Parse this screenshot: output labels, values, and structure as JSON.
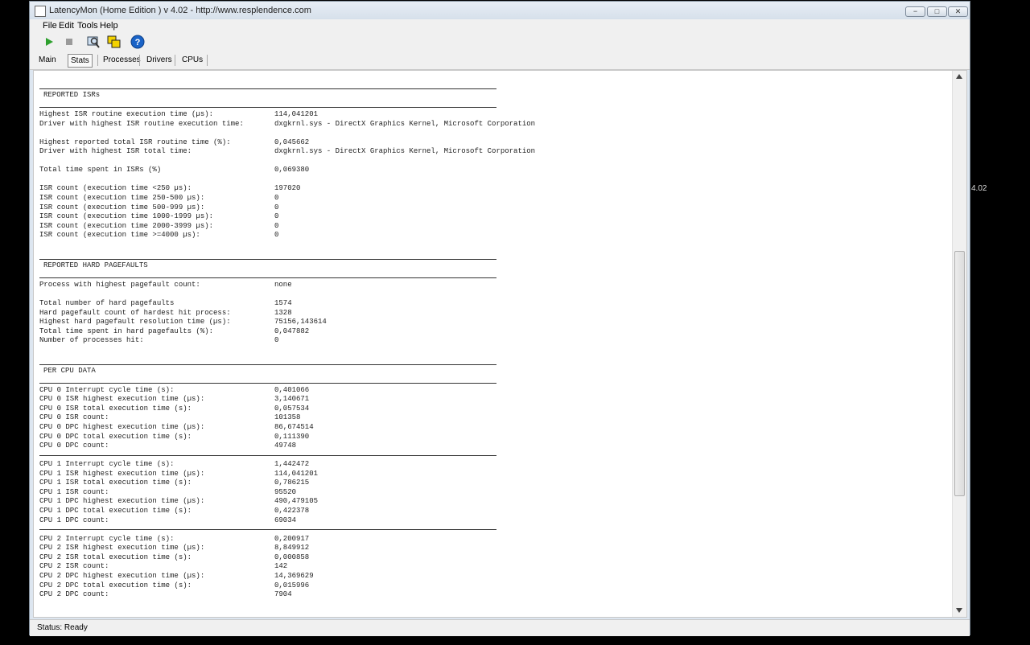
{
  "background_label": "4.02",
  "window": {
    "title": "LatencyMon  (Home Edition )  v 4.02 - http://www.resplendence.com",
    "minimize": "−",
    "maximize": "□",
    "close": "✕"
  },
  "menu": [
    "File",
    "Edit",
    "Tools",
    "Help"
  ],
  "toolbar_icons": [
    "play-icon",
    "stop-icon",
    "search-icon",
    "windows-icon",
    "help-icon"
  ],
  "tabs": [
    "Main",
    "Stats",
    "Processes",
    "Drivers",
    "CPUs"
  ],
  "active_tab": "Stats",
  "sections": [
    {
      "header": "REPORTED ISRs",
      "groups": [
        [
          {
            "label": "Highest ISR routine execution time (µs):",
            "value": "114,041201"
          },
          {
            "label": "Driver with highest ISR routine execution time:",
            "value": "dxgkrnl.sys - DirectX Graphics Kernel, Microsoft Corporation"
          }
        ],
        [
          {
            "label": "Highest reported total ISR routine time (%):",
            "value": "0,045662"
          },
          {
            "label": "Driver with highest ISR total time:",
            "value": "dxgkrnl.sys - DirectX Graphics Kernel, Microsoft Corporation"
          }
        ],
        [
          {
            "label": "Total time spent in ISRs (%)",
            "value": "0,069380"
          }
        ],
        [
          {
            "label": "ISR count (execution time <250 µs):",
            "value": "197020"
          },
          {
            "label": "ISR count (execution time 250-500 µs):",
            "value": "0"
          },
          {
            "label": "ISR count (execution time 500-999 µs):",
            "value": "0"
          },
          {
            "label": "ISR count (execution time 1000-1999 µs):",
            "value": "0"
          },
          {
            "label": "ISR count (execution time 2000-3999 µs):",
            "value": "0"
          },
          {
            "label": "ISR count (execution time >=4000 µs):",
            "value": "0"
          }
        ]
      ]
    },
    {
      "header": "REPORTED HARD PAGEFAULTS",
      "groups": [
        [
          {
            "label": "Process with highest pagefault count:",
            "value": "none"
          }
        ],
        [
          {
            "label": "Total number of hard pagefaults",
            "value": "1574"
          },
          {
            "label": "Hard pagefault count of hardest hit process:",
            "value": "1328"
          },
          {
            "label": "Highest hard pagefault resolution time (µs):",
            "value": "75156,143614"
          },
          {
            "label": "Total time spent in hard pagefaults (%):",
            "value": "0,047882"
          },
          {
            "label": "Number of processes hit:",
            "value": "0"
          }
        ]
      ]
    },
    {
      "header": "PER CPU DATA",
      "groups": [
        [
          {
            "label": "CPU 0 Interrupt cycle time (s):",
            "value": "0,401066"
          },
          {
            "label": "CPU 0 ISR highest execution time (µs):",
            "value": "3,140671"
          },
          {
            "label": "CPU 0 ISR total execution time (s):",
            "value": "0,057534"
          },
          {
            "label": "CPU 0 ISR count:",
            "value": "101358"
          },
          {
            "label": "CPU 0 DPC highest execution time (µs):",
            "value": "86,674514"
          },
          {
            "label": "CPU 0 DPC total execution time (s):",
            "value": "0,111390"
          },
          {
            "label": "CPU 0 DPC count:",
            "value": "49748"
          }
        ],
        [
          {
            "label": "CPU 1 Interrupt cycle time (s):",
            "value": "1,442472"
          },
          {
            "label": "CPU 1 ISR highest execution time (µs):",
            "value": "114,041201"
          },
          {
            "label": "CPU 1 ISR total execution time (s):",
            "value": "0,786215"
          },
          {
            "label": "CPU 1 ISR count:",
            "value": "95520"
          },
          {
            "label": "CPU 1 DPC highest execution time (µs):",
            "value": "490,479105"
          },
          {
            "label": "CPU 1 DPC total execution time (s):",
            "value": "0,422378"
          },
          {
            "label": "CPU 1 DPC count:",
            "value": "69034"
          }
        ],
        [
          {
            "label": "CPU 2 Interrupt cycle time (s):",
            "value": "0,200917"
          },
          {
            "label": "CPU 2 ISR highest execution time (µs):",
            "value": "8,849912"
          },
          {
            "label": "CPU 2 ISR total execution time (s):",
            "value": "0,000858"
          },
          {
            "label": "CPU 2 ISR count:",
            "value": "142"
          },
          {
            "label": "CPU 2 DPC highest execution time (µs):",
            "value": "14,369629"
          },
          {
            "label": "CPU 2 DPC total execution time (s):",
            "value": "0,015996"
          },
          {
            "label": "CPU 2 DPC count:",
            "value": "7904"
          }
        ]
      ]
    }
  ],
  "scroll_position": 0.6,
  "status": "Status: Ready",
  "colors": {
    "window_bg": "#dde6f0",
    "content_bg": "#ffffff",
    "play_green": "#2ea02e",
    "help_blue": "#1a63c7"
  }
}
